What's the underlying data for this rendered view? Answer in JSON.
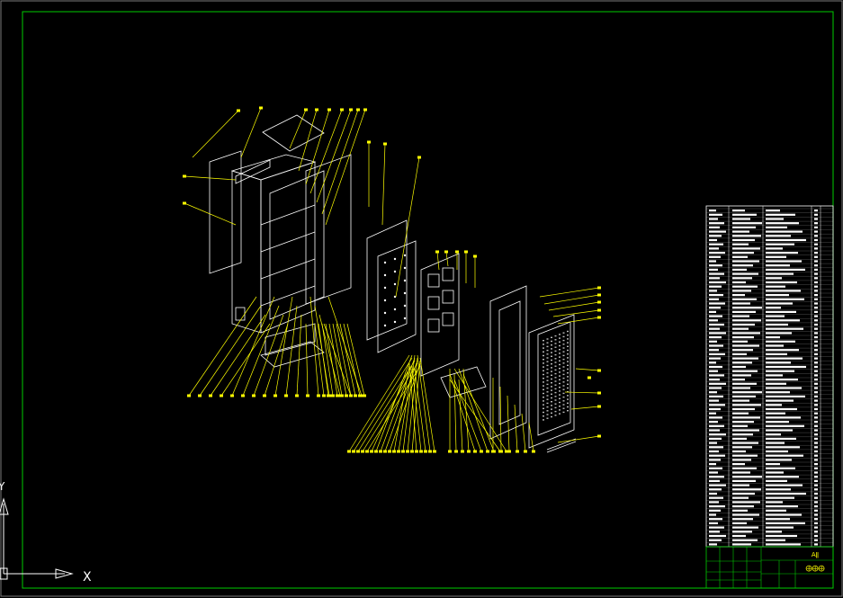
{
  "drawing": {
    "colors": {
      "background": "#000000",
      "border": "#00cc00",
      "model": "#ffffff",
      "callout": "#ffff00",
      "table_lines": "#00cc00"
    },
    "ucs": {
      "x_label": "X",
      "y_label": "Y"
    },
    "title_block": {
      "text_a": "Aǁ",
      "text_b": "⨁⨁⨁"
    }
  }
}
